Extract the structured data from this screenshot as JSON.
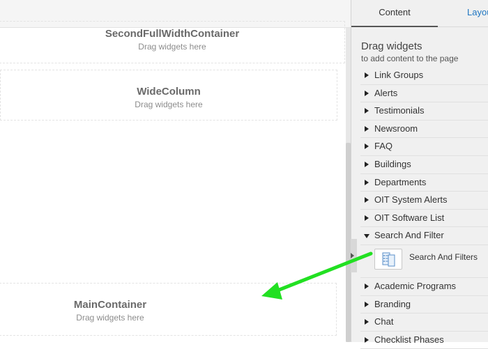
{
  "editor": {
    "zones": [
      {
        "title": "SecondFullWidthContainer",
        "sub": "Drag widgets here"
      },
      {
        "title": "WideColumn",
        "sub": "Drag widgets here"
      },
      {
        "title": "MainContainer",
        "sub": "Drag widgets here"
      }
    ]
  },
  "panel": {
    "tabs": {
      "content": "Content",
      "layout": "Layou"
    },
    "heading": "Drag widgets",
    "subheading": "to add content to the page",
    "items": [
      "Link Groups",
      "Alerts",
      "Testimonials",
      "Newsroom",
      "FAQ",
      "Buildings",
      "Departments",
      "OIT System Alerts",
      "OIT Software List",
      "Search And Filter"
    ],
    "expanded_widget": {
      "label": "Search And Filters",
      "icon": "widget-list-icon"
    },
    "items_after": [
      "Academic Programs",
      "Branding",
      "Chat",
      "Checklist Phases"
    ]
  },
  "annotation": {
    "arrow_color": "#22e022"
  }
}
